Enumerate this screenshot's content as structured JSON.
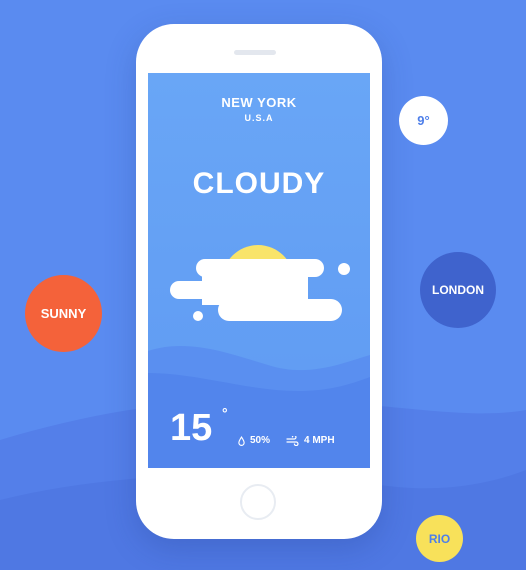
{
  "location": {
    "city": "NEW YORK",
    "country": "U.S.A"
  },
  "weather": {
    "condition": "CLOUDY",
    "temperature": "15",
    "degree_symbol": "°",
    "humidity": "50%",
    "wind": "4 MPH"
  },
  "bubbles": {
    "sunny": "SUNNY",
    "london": "LONDON",
    "temp": "9°",
    "rio": "RIO"
  },
  "colors": {
    "background": "#5a8bf0",
    "screen": "#69a6f6",
    "sun": "#f9e46a",
    "sunny_bubble": "#f4623a",
    "london_bubble": "#3f63cd",
    "rio_bubble": "#f8e15a"
  },
  "icons": {
    "humidity": "droplet-icon",
    "wind": "wind-icon",
    "weather": "sun-cloud-icon"
  }
}
